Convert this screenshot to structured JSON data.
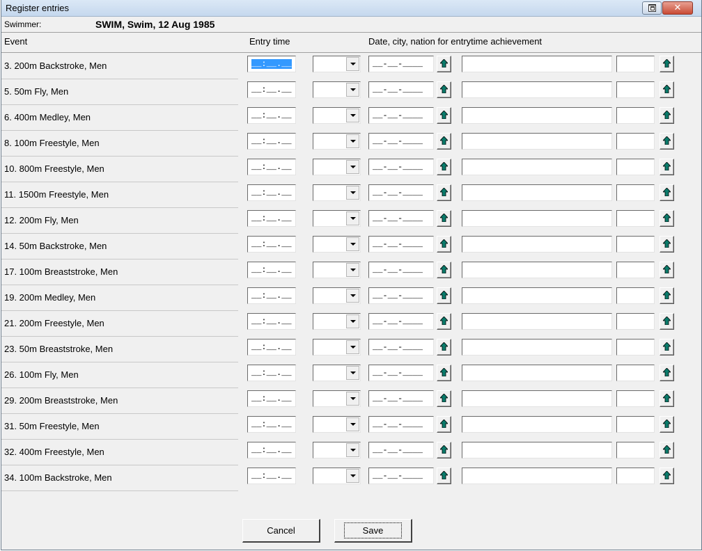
{
  "window": {
    "title": "Register entries",
    "restore_icon": "restore-icon",
    "close_glyph": "✕",
    "close_icon": "close-icon"
  },
  "swimmer": {
    "label": "Swimmer:",
    "name": "SWIM, Swim, 12 Aug 1985"
  },
  "headers": {
    "event": "Event",
    "entry_time": "Entry time",
    "date_city_nation": "Date, city, nation for entrytime achievement"
  },
  "time_mask": "__:__.__",
  "date_mask": "__-__-____",
  "up_icon": "up-arrow-icon",
  "up_color": "#0a7a6a",
  "events": [
    "3. 200m Backstroke, Men",
    "5. 50m Fly, Men",
    "6. 400m Medley, Men",
    "8. 100m Freestyle, Men",
    "10. 800m Freestyle, Men",
    "11. 1500m Freestyle, Men",
    "12. 200m Fly, Men",
    "14. 50m Backstroke, Men",
    "17. 100m Breaststroke, Men",
    "19. 200m Medley, Men",
    "21. 200m Freestyle, Men",
    "23. 50m Breaststroke, Men",
    "26. 100m Fly, Men",
    "29. 200m Breaststroke, Men",
    "31. 50m Freestyle, Men",
    "32. 400m Freestyle, Men",
    "34. 100m Backstroke, Men"
  ],
  "buttons": {
    "cancel": "Cancel",
    "save": "Save"
  }
}
